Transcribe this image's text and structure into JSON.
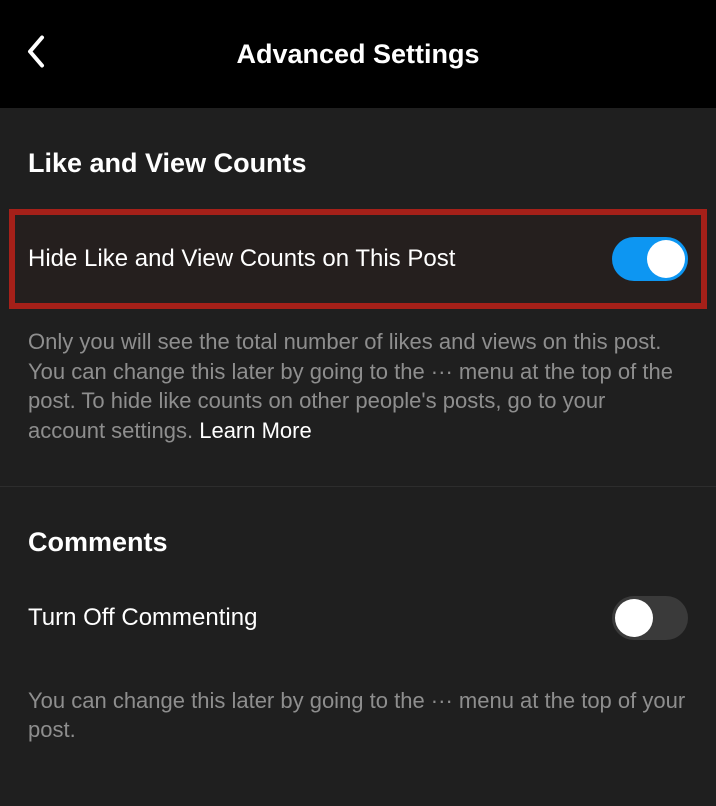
{
  "header": {
    "title": "Advanced Settings"
  },
  "sections": {
    "likes": {
      "title": "Like and View Counts",
      "toggle_label": "Hide Like and View Counts on This Post",
      "toggle_on": true,
      "description_pre": "Only you will see the total number of likes and views on this post. You can change this later by going to the ··· menu at the top of the post. To hide like counts on other people's posts, go to your account settings. ",
      "learn_more": "Learn More"
    },
    "comments": {
      "title": "Comments",
      "toggle_label": "Turn Off Commenting",
      "toggle_on": false,
      "description": "You can change this later by going to the ··· menu at the top of your post."
    }
  }
}
